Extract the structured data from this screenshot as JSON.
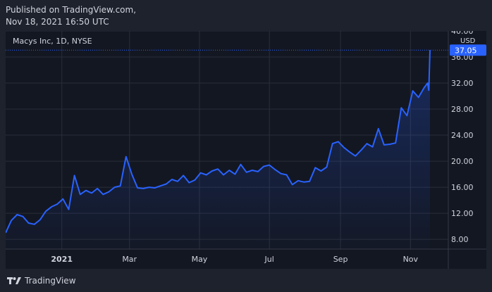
{
  "published": {
    "line1": "Published on TradingView.com,",
    "line2": "Nov 18, 2021 16:50 UTC"
  },
  "symbol_label": "Macys Inc, 1D, NYSE",
  "footer": {
    "brand": "TradingView",
    "logo_icon": "tradingview-logo-icon"
  },
  "colors": {
    "background": "#1e222d",
    "plot_background": "#131722",
    "line": "#2962ff",
    "grid": "#2a2e39",
    "text": "#d1d4dc",
    "price_tag": "#2962ff"
  },
  "chart_data": {
    "type": "area",
    "title": "Macys Inc, 1D, NYSE",
    "ylabel": "USD",
    "ylim": [
      6.5,
      40
    ],
    "y_ticks": [
      "40.00",
      "36.00",
      "32.00",
      "28.00",
      "24.00",
      "20.00",
      "16.00",
      "12.00",
      "8.00"
    ],
    "y_tick_values": [
      40,
      36,
      32,
      28,
      24,
      20,
      16,
      12,
      8
    ],
    "x_ticks": [
      "2021",
      "Mar",
      "May",
      "Jul",
      "Sep",
      "Nov"
    ],
    "x_tick_dates": [
      "2021-01-01",
      "2021-03-01",
      "2021-05-01",
      "2021-07-01",
      "2021-09-01",
      "2021-11-01"
    ],
    "xlim": [
      "2020-11-13",
      "2021-12-04"
    ],
    "grid": true,
    "last_price": "37.05",
    "last_value": 37.05,
    "series": [
      {
        "x": [
          "2020-11-13",
          "2020-11-18",
          "2020-11-23",
          "2020-11-28",
          "2020-12-03",
          "2020-12-08",
          "2020-12-13",
          "2020-12-18",
          "2020-12-23",
          "2020-12-28",
          "2021-01-02",
          "2021-01-07",
          "2021-01-12",
          "2021-01-17",
          "2021-01-22",
          "2021-01-27",
          "2021-02-01",
          "2021-02-06",
          "2021-02-11",
          "2021-02-16",
          "2021-02-21",
          "2021-02-26",
          "2021-03-03",
          "2021-03-08",
          "2021-03-13",
          "2021-03-18",
          "2021-03-23",
          "2021-03-28",
          "2021-04-02",
          "2021-04-07",
          "2021-04-12",
          "2021-04-17",
          "2021-04-22",
          "2021-04-27",
          "2021-05-02",
          "2021-05-07",
          "2021-05-12",
          "2021-05-17",
          "2021-05-22",
          "2021-05-27",
          "2021-06-01",
          "2021-06-06",
          "2021-06-11",
          "2021-06-16",
          "2021-06-21",
          "2021-06-26",
          "2021-07-01",
          "2021-07-06",
          "2021-07-11",
          "2021-07-16",
          "2021-07-21",
          "2021-07-26",
          "2021-07-31",
          "2021-08-05",
          "2021-08-10",
          "2021-08-15",
          "2021-08-20",
          "2021-08-25",
          "2021-08-30",
          "2021-09-04",
          "2021-09-09",
          "2021-09-14",
          "2021-09-19",
          "2021-09-24",
          "2021-09-29",
          "2021-10-04",
          "2021-10-09",
          "2021-10-14",
          "2021-10-19",
          "2021-10-24",
          "2021-10-29",
          "2021-11-03",
          "2021-11-08",
          "2021-11-13",
          "2021-11-16",
          "2021-11-17",
          "2021-11-18"
        ],
        "values": [
          9.0,
          10.9,
          11.8,
          11.5,
          10.5,
          10.3,
          11.0,
          12.3,
          13.0,
          13.4,
          14.2,
          12.6,
          17.8,
          14.9,
          15.5,
          15.1,
          15.8,
          14.9,
          15.3,
          16.0,
          16.2,
          20.7,
          18.0,
          15.9,
          15.8,
          16.0,
          15.9,
          16.2,
          16.5,
          17.2,
          16.9,
          17.8,
          16.7,
          17.1,
          18.2,
          17.9,
          18.5,
          18.8,
          17.9,
          18.6,
          18.0,
          19.5,
          18.3,
          18.6,
          18.4,
          19.2,
          19.4,
          18.7,
          18.1,
          17.9,
          16.4,
          17.0,
          16.8,
          16.9,
          19.0,
          18.5,
          19.1,
          22.7,
          23.0,
          22.1,
          21.4,
          20.8,
          21.7,
          22.7,
          22.2,
          25.0,
          22.5,
          22.6,
          22.8,
          28.2,
          27.0,
          30.8,
          29.8,
          31.3,
          32.0,
          30.9,
          37.05
        ]
      }
    ]
  }
}
